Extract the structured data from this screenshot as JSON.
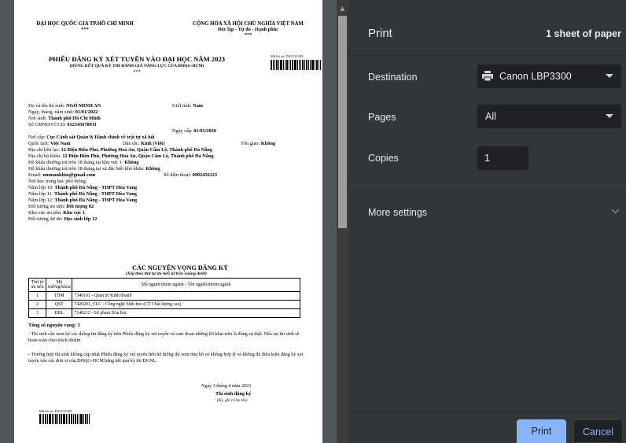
{
  "preview": {
    "header_left": {
      "line1": "ĐẠI HỌC QUỐC GIA TP.HỒ CHÍ MINH",
      "stars": "***"
    },
    "header_right": {
      "line1": "CỘNG HÒA XÃ HỘI CHỦ NGHĨA VIỆT NAM",
      "line2": "Độc lập - Tự do - Hạnh phúc",
      "stars": "***"
    },
    "title": "PHIẾU ĐĂNG KÝ XÉT TUYỂN VÀO ĐẠI HỌC NĂM 2023",
    "subtitle": "(DÙNG KẾT QUẢ KỲ THI ĐÁNH GIÁ NĂNG LỰC CỦA ĐHQG-HCM)",
    "title_stars": "***",
    "file_code_label": "Mã hồ sơ: D23131303",
    "info": {
      "name_label": "Họ và tên thí sinh: ",
      "name": "NGÔ MINH AN",
      "gender_label": "Giới tính: ",
      "gender": "Nam",
      "dob_label": "Ngày, tháng, năm sinh: ",
      "dob": "01/01/2022",
      "pob_label": "Nơi sinh: ",
      "pob": "Thành phố Hồ Chí Minh",
      "id_label": "Số CMND/CCCD: ",
      "id": "012345678911",
      "issue_date_label": "Ngày cấp: ",
      "issue_date": "01/01/2020",
      "issuer_label": "Nơi cấp: ",
      "issuer": "Cục Cảnh sát Quản lý Hành chính về trật tự xã hội",
      "nationality_label": "Quốc tịch: ",
      "nationality": "Việt Nam",
      "ethnic_label": "Dân tộc: ",
      "ethnic": "Kinh (Việt)",
      "religion_label": "Tôn giáo: ",
      "religion": "Không",
      "contact_label": "Địa chỉ liên lạc: ",
      "contact": "12 Điện Biên Phủ, Phường Hoà An, Quận Cẩm Lệ, Thành phố Đà Nẵng",
      "household_label": "Địa chỉ hộ khẩu: ",
      "household": "12 Điện Biên Phủ, Phường Hoà An, Quận Cẩm Lệ, Thành phố Đà Nẵng",
      "area1_label": "Hộ khẩu thường trú trên 18 tháng tại khu vực 1: ",
      "area1": "Không",
      "area2_label": "Hộ khẩu thường trú trên 18 tháng tại xã đặc biệt khó khăn: ",
      "area2": "Không",
      "email_label": "Email: ",
      "email": "nmmankhtn@gmail.com",
      "phone_label": "Số điện thoại: ",
      "phone": "0902456123",
      "school_label": "Nơi học trung học phổ thông:",
      "g10_label": "Năm lớp 10: ",
      "g10": "Thành phố Đà Nẵng - THPT Hòa Vang",
      "g11_label": "Năm lớp 11: ",
      "g11": "Thành phố Đà Nẵng - THPT Hòa Vang",
      "g12_label": "Năm lớp 12: ",
      "g12": "Thành phố Đà Nẵng - THPT Hòa Vang",
      "priority_label": "Đối tượng ưu tiên: ",
      "priority": "Đối tượng 02",
      "zone_label": "Khu vực ưu tiên: ",
      "zone": "Khu vực 1",
      "exam_label": "Đối tượng dự thi: ",
      "exam": "Học sinh lớp 12"
    },
    "wishes_title": "CÁC NGUYỆN VỌNG ĐĂNG KÝ",
    "wishes_subtitle": "(Xếp theo thứ tự ưu tiên từ trên xuống dưới)",
    "wish_headers": [
      "Thứ tự ưu tiên",
      "Mã trường/khoa",
      "Mã ngành/nhóm ngành - Tên ngành/nhóm ngành"
    ],
    "wish_rows": [
      [
        "1",
        "TDM",
        "7340101 - Quản trị Kinh doanh"
      ],
      [
        "2",
        "QST",
        "7420201_CLC - Công nghệ Sinh học (CT Chất lượng cao)"
      ],
      [
        "3",
        "DBL",
        "7140212 - Sư phạm Hóa học"
      ]
    ],
    "total_wishes": "Tổng số nguyện vọng: 3",
    "note1": "- Thí sinh cần xem kỹ các thông tin đăng ký trên Phiếu đăng ký xét tuyển và cam đoan những lời khai trên là đúng sự thật. Nếu sai thí sinh sẽ hoàn toàn chịu trách nhiệm.",
    "note2": "- Trường hợp thí sinh không cập nhật Phiếu đăng ký xét tuyển liên hệ thống thì xem như hồ sơ không hợp lệ và không đủ điều kiện đăng ký xét tuyển vào các đơn vị của ĐHQG-HCM bằng kết quả kỳ thi ĐGNL.",
    "sign_date": "Ngày 3 tháng 4 năm 2023",
    "sign_title": "Thí sinh đăng ký",
    "sign_note": "(Ký, ghi rõ họ tên)"
  },
  "panel": {
    "title": "Print",
    "sheet_count": "1 sheet of paper",
    "destination_label": "Destination",
    "destination_value": "Canon LBP3300",
    "pages_label": "Pages",
    "pages_value": "All",
    "copies_label": "Copies",
    "copies_value": "1",
    "more_settings": "More settings",
    "print_button": "Print",
    "cancel_button": "Cancel"
  },
  "colors": {
    "panel_bg": "#323639",
    "accent": "#8ab4f8",
    "field_bg": "#202124"
  }
}
